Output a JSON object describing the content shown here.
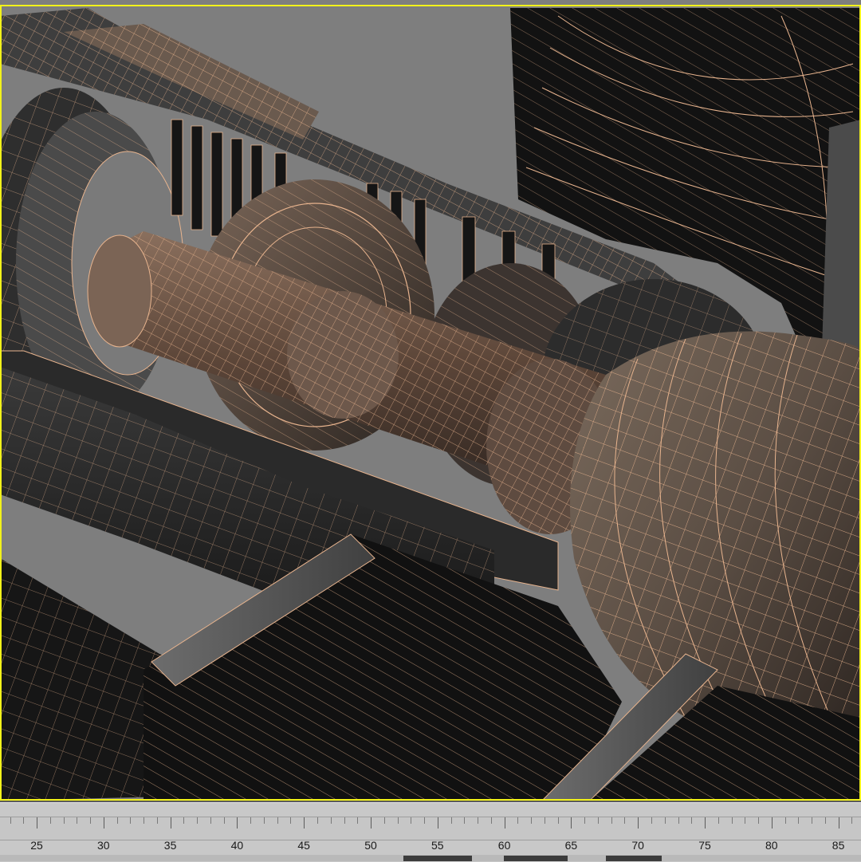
{
  "viewport": {
    "name": "perspective-viewport",
    "active_border_color": "#f2f21a",
    "background_color": "#7e7e7e",
    "wire_color": "#e8b48e",
    "model_subject": "jet-engine-cutaway"
  },
  "trackbar": {
    "tick_labels": [
      "25",
      "30",
      "35",
      "40",
      "45",
      "50",
      "55",
      "60",
      "65",
      "70",
      "75",
      "80",
      "85"
    ]
  }
}
